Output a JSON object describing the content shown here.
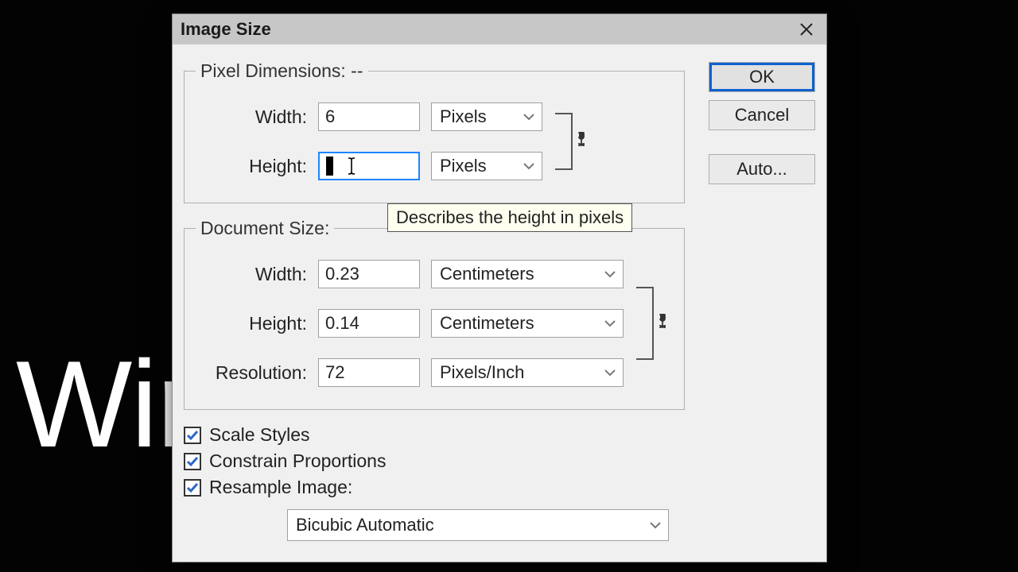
{
  "background_text": "Wir",
  "dialog": {
    "title": "Image Size",
    "buttons": {
      "ok": "OK",
      "cancel": "Cancel",
      "auto": "Auto..."
    },
    "pixel_dimensions": {
      "legend": "Pixel Dimensions:   --",
      "width_label": "Width:",
      "width_value": "6",
      "width_unit": "Pixels",
      "height_label": "Height:",
      "height_value": "",
      "height_unit": "Pixels",
      "tooltip": "Describes the height in pixels"
    },
    "document_size": {
      "legend": "Document Size:",
      "width_label": "Width:",
      "width_value": "0.23",
      "width_unit": "Centimeters",
      "height_label": "Height:",
      "height_value": "0.14",
      "height_unit": "Centimeters",
      "resolution_label": "Resolution:",
      "resolution_value": "72",
      "resolution_unit": "Pixels/Inch"
    },
    "checkboxes": {
      "scale_styles": {
        "label": "Scale Styles",
        "checked": true
      },
      "constrain_proportions": {
        "label": "Constrain Proportions",
        "checked": true
      },
      "resample_image": {
        "label": "Resample Image:",
        "checked": true
      }
    },
    "resample_method": "Bicubic Automatic"
  }
}
